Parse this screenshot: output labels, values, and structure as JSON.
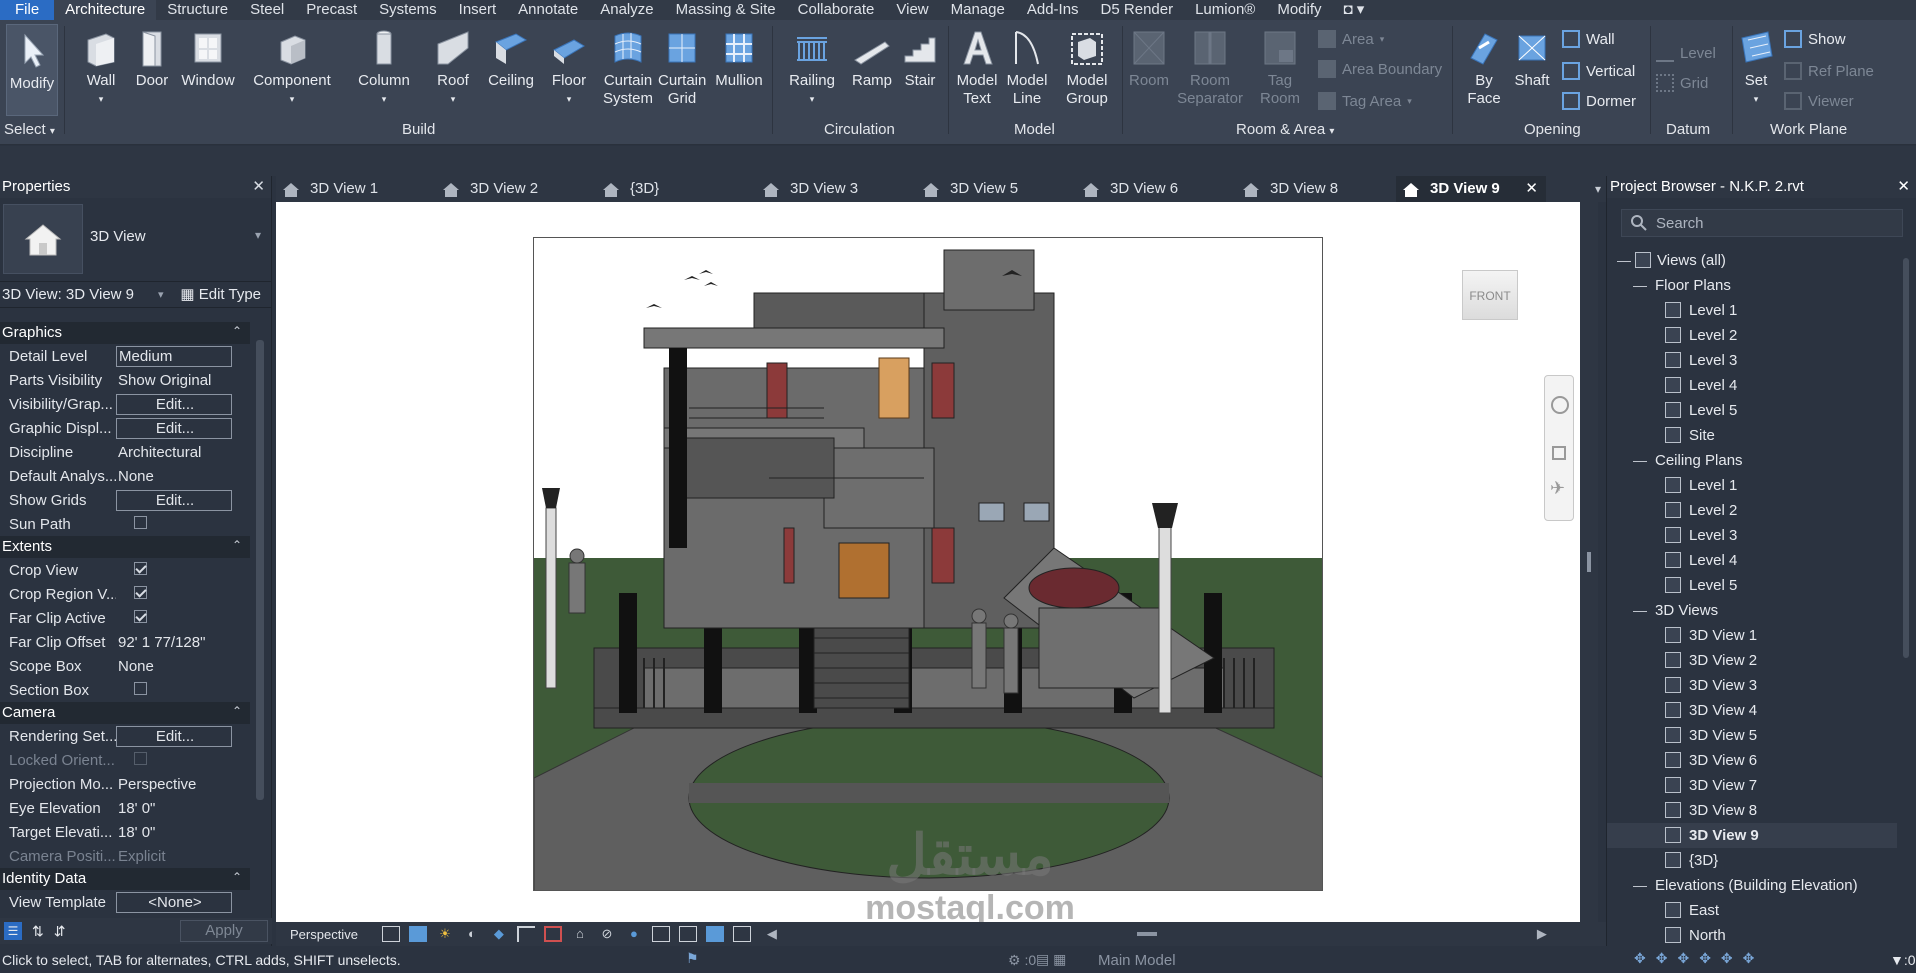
{
  "menu": {
    "items": [
      "File",
      "Architecture",
      "Structure",
      "Steel",
      "Precast",
      "Systems",
      "Insert",
      "Annotate",
      "Analyze",
      "Massing & Site",
      "Collaborate",
      "View",
      "Manage",
      "Add-Ins",
      "D5 Render",
      "Lumion®",
      "Modify"
    ],
    "active": "Architecture"
  },
  "ribbon": {
    "select": {
      "modify": "Modify",
      "select_label": "Select"
    },
    "build": {
      "label": "Build",
      "wall": "Wall",
      "door": "Door",
      "window": "Window",
      "component": "Component",
      "column": "Column",
      "roof": "Roof",
      "ceiling": "Ceiling",
      "floor": "Floor",
      "curtain_system_1": "Curtain",
      "curtain_system_2": "System",
      "curtain_grid_1": "Curtain",
      "curtain_grid_2": "Grid",
      "mullion": "Mullion"
    },
    "circulation": {
      "label": "Circulation",
      "railing": "Railing",
      "ramp": "Ramp",
      "stair": "Stair"
    },
    "model": {
      "label": "Model",
      "model_text_1": "Model",
      "model_text_2": "Text",
      "model_line_1": "Model",
      "model_line_2": "Line",
      "model_group_1": "Model",
      "model_group_2": "Group"
    },
    "room_area": {
      "label": "Room & Area",
      "room": "Room",
      "room_sep_1": "Room",
      "room_sep_2": "Separator",
      "tag_room_1": "Tag",
      "tag_room_2": "Room",
      "area": "Area",
      "area_boundary": "Area  Boundary",
      "tag_area": "Tag  Area"
    },
    "opening": {
      "label": "Opening",
      "by_face_1": "By",
      "by_face_2": "Face",
      "shaft": "Shaft",
      "wall": "Wall",
      "vertical": "Vertical",
      "dormer": "Dormer"
    },
    "datum": {
      "label": "Datum",
      "level": "Level",
      "grid": "Grid"
    },
    "work_plane": {
      "label": "Work Plane",
      "set": "Set",
      "show": "Show",
      "ref_plane": "Ref  Plane",
      "viewer": "Viewer"
    }
  },
  "properties": {
    "title": "Properties",
    "type_name": "3D View",
    "view_selector": "3D View: 3D View 9",
    "edit_type": "Edit Type",
    "sections": {
      "graphics": "Graphics",
      "extents": "Extents",
      "camera": "Camera",
      "identity": "Identity Data"
    },
    "rows": {
      "detail_level": {
        "k": "Detail Level",
        "v": "Medium"
      },
      "parts_visibility": {
        "k": "Parts Visibility",
        "v": "Show Original"
      },
      "visibility_graphics": {
        "k": "Visibility/Grap...",
        "v": "Edit..."
      },
      "graphic_display": {
        "k": "Graphic Displ...",
        "v": "Edit..."
      },
      "discipline": {
        "k": "Discipline",
        "v": "Architectural"
      },
      "default_analysis": {
        "k": "Default Analys...",
        "v": "None"
      },
      "show_grids": {
        "k": "Show Grids",
        "v": "Edit..."
      },
      "sun_path": {
        "k": "Sun Path"
      },
      "crop_view": {
        "k": "Crop View"
      },
      "crop_region": {
        "k": "Crop Region V..."
      },
      "far_clip_active": {
        "k": "Far Clip Active"
      },
      "far_clip_offset": {
        "k": "Far Clip Offset",
        "v": "92'  1 77/128\""
      },
      "scope_box": {
        "k": "Scope Box",
        "v": "None"
      },
      "section_box": {
        "k": "Section Box"
      },
      "rendering_settings": {
        "k": "Rendering Set...",
        "v": "Edit..."
      },
      "locked_orientation": {
        "k": "Locked Orient..."
      },
      "projection_mode": {
        "k": "Projection Mo...",
        "v": "Perspective"
      },
      "eye_elevation": {
        "k": "Eye Elevation",
        "v": "18'  0\""
      },
      "target_elevation": {
        "k": "Target Elevati...",
        "v": "18'  0\""
      },
      "camera_position": {
        "k": "Camera Positi...",
        "v": "Explicit"
      },
      "view_template": {
        "k": "View Template",
        "v": "<None>"
      }
    },
    "apply": "Apply"
  },
  "tabs": [
    "3D View 1",
    "3D View 2",
    "{3D}",
    "3D View 3",
    "3D View 5",
    "3D View 6",
    "3D View 8",
    "3D View 9"
  ],
  "active_tab": "3D View 9",
  "viewcube": "FRONT",
  "view_control_bar": {
    "projection": "Perspective"
  },
  "watermark": {
    "arabic": "مستقل",
    "latin": "mostaql.com"
  },
  "project_browser": {
    "title": "Project Browser - N.K.P. 2.rvt",
    "search_placeholder": "Search",
    "root": "Views (all)",
    "floor_plans": {
      "label": "Floor Plans",
      "items": [
        "Level 1",
        "Level 2",
        "Level 3",
        "Level 4",
        "Level 5",
        "Site"
      ]
    },
    "ceiling_plans": {
      "label": "Ceiling Plans",
      "items": [
        "Level 1",
        "Level 2",
        "Level 3",
        "Level 4",
        "Level 5"
      ]
    },
    "views_3d": {
      "label": "3D Views",
      "items": [
        "3D View 1",
        "3D View 2",
        "3D View 3",
        "3D View 4",
        "3D View 5",
        "3D View 6",
        "3D View 7",
        "3D View 8",
        "3D View 9",
        "{3D}"
      ]
    },
    "elevations": {
      "label": "Elevations (Building Elevation)",
      "items": [
        "East",
        "North"
      ]
    },
    "selected": "3D View 9"
  },
  "status": {
    "message": "Click to select, TAB for alternates, CTRL adds, SHIFT unselects.",
    "count": ":0",
    "model": "Main Model",
    "filter_count": ":0"
  }
}
